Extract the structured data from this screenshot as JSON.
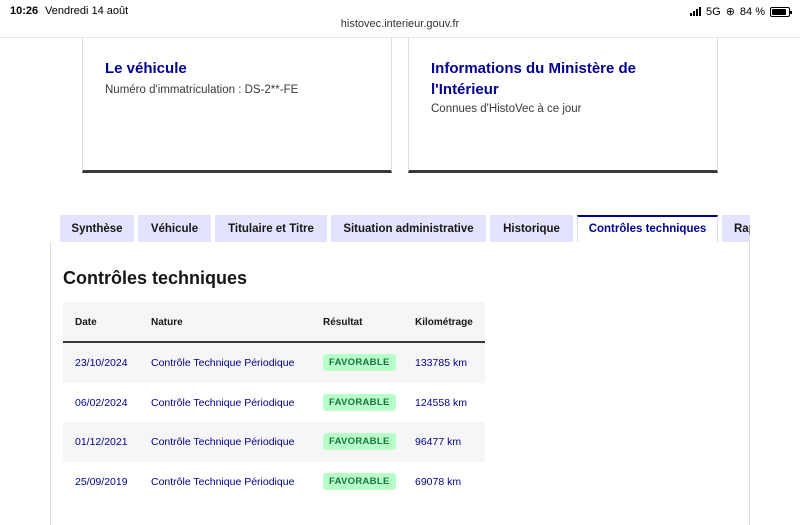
{
  "statusbar": {
    "time": "10:26",
    "date": "Vendredi 14 août",
    "network": "5G",
    "battery": "84 %"
  },
  "browser": {
    "url": "histovec.interieur.gouv.fr"
  },
  "cards": {
    "vehicle": {
      "title": "Le véhicule",
      "subtitle": "Numéro d'immatriculation : DS-2**-FE"
    },
    "ministry": {
      "title": "Informations du Ministère de l'Intérieur",
      "subtitle": "Connues d'HistoVec à ce jour"
    }
  },
  "tabs": [
    {
      "label": "Synthèse",
      "active": false
    },
    {
      "label": "Véhicule",
      "active": false
    },
    {
      "label": "Titulaire et Titre",
      "active": false
    },
    {
      "label": "Situation administrative",
      "active": false
    },
    {
      "label": "Historique",
      "active": false
    },
    {
      "label": "Contrôles techniques",
      "active": true
    },
    {
      "label": "Rap",
      "active": false
    }
  ],
  "section": {
    "title": "Contrôles techniques",
    "columns": [
      "Date",
      "Nature",
      "Résultat",
      "Kilométrage"
    ],
    "rows": [
      {
        "date": "23/10/2024",
        "nature": "Contrôle Technique Périodique",
        "result": "FAVORABLE",
        "km": "133785 km"
      },
      {
        "date": "06/02/2024",
        "nature": "Contrôle Technique Périodique",
        "result": "FAVORABLE",
        "km": "124558 km"
      },
      {
        "date": "01/12/2021",
        "nature": "Contrôle Technique Périodique",
        "result": "FAVORABLE",
        "km": "96477 km"
      },
      {
        "date": "25/09/2019",
        "nature": "Contrôle Technique Périodique",
        "result": "FAVORABLE",
        "km": "69078 km"
      }
    ]
  },
  "colors": {
    "accent": "#000091",
    "tab_bg": "#e3e3fd",
    "badge_bg": "#b8fec9",
    "badge_text": "#18753c"
  }
}
